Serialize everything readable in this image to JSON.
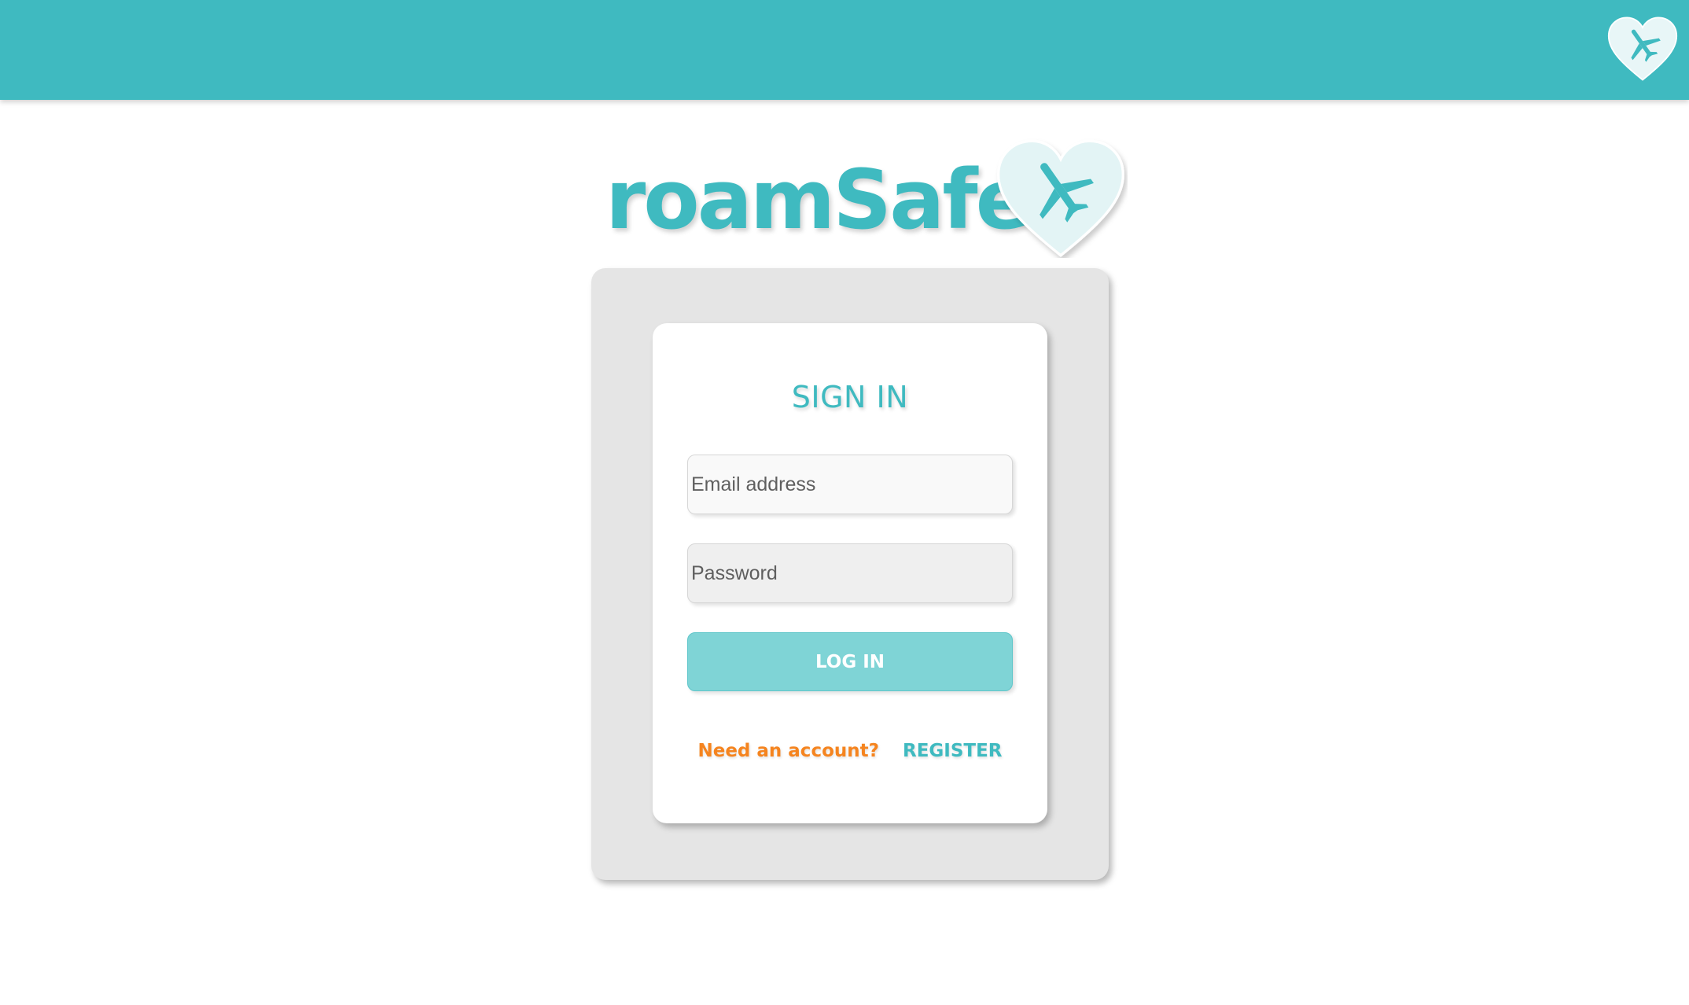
{
  "brand": {
    "name": "roamSafe",
    "icon": "heart-airplane-icon",
    "primary_color": "#3fbac0",
    "heart_fill": "#e3f4f5"
  },
  "topbar": {
    "logo_icon": "heart-airplane-icon"
  },
  "signin": {
    "title": "SIGN IN",
    "email_placeholder": "Email address",
    "password_placeholder": "Password",
    "login_label": "LOG IN",
    "need_account_text": "Need an account?",
    "register_label": "REGISTER"
  },
  "colors": {
    "accent": "#3fbac0",
    "button": "#7fd4d6",
    "link_orange": "#f5841f",
    "panel": "#e5e5e5"
  }
}
